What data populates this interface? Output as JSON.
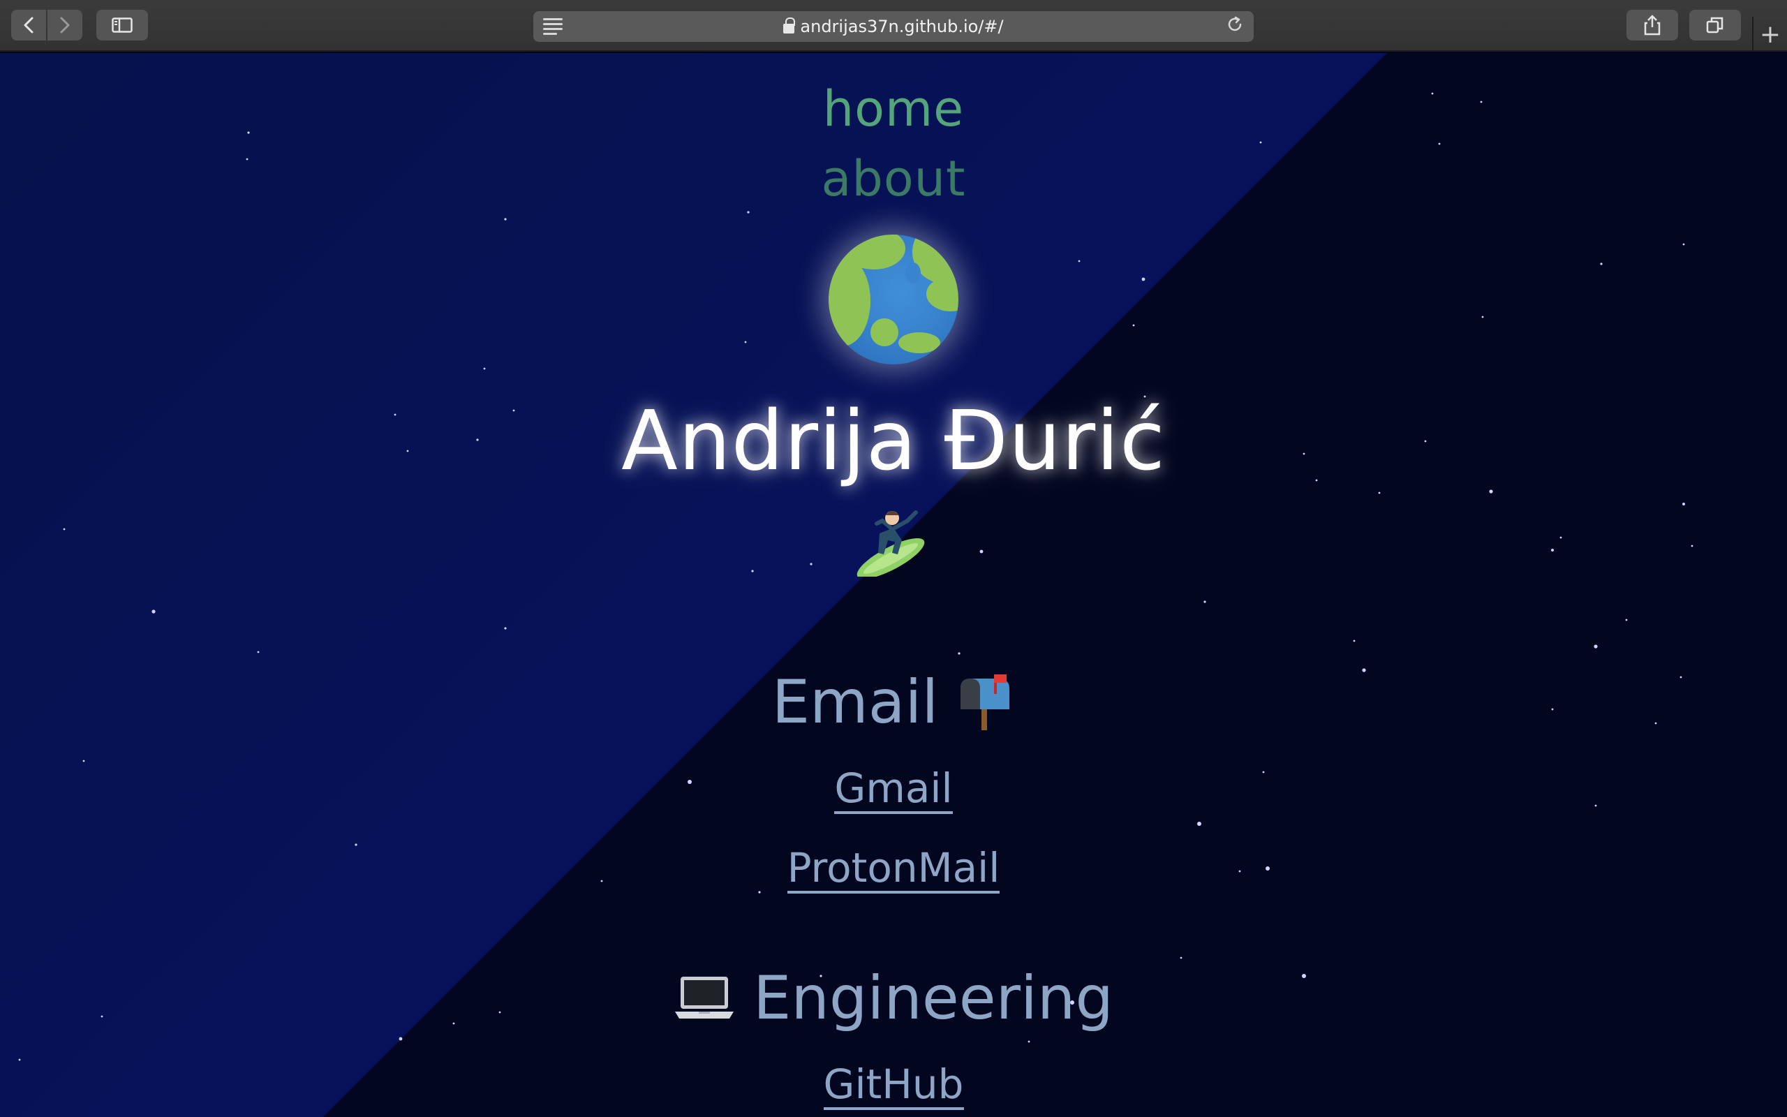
{
  "browser": {
    "url": "andrijas37n.github.io/#/",
    "back_icon": "chevron-left-icon",
    "forward_icon": "chevron-right-icon",
    "sidebar_icon": "sidebar-icon",
    "reader_icon": "reader-icon",
    "lock_icon": "lock-icon",
    "reload_icon": "reload-icon",
    "share_icon": "share-icon",
    "tabs_icon": "tabs-icon",
    "new_tab_icon": "plus-icon"
  },
  "nav": {
    "home": "home",
    "about": "about"
  },
  "hero": {
    "globe_icon": "earth-globe-icon",
    "name": "Andrija Đurić",
    "surfer_icon": "surfer-emoji-icon"
  },
  "sections": {
    "email": {
      "title": "Email",
      "icon": "mailbox-icon",
      "links": [
        "Gmail",
        "ProtonMail"
      ]
    },
    "engineering": {
      "title": "Engineering",
      "icon": "laptop-icon",
      "links": [
        "GitHub"
      ]
    }
  },
  "colors": {
    "bg_left": "#07125a",
    "bg_right": "#03061f",
    "nav_home": "#54a67a",
    "nav_about": "#3b7b66",
    "section_text": "#8da6c6"
  }
}
